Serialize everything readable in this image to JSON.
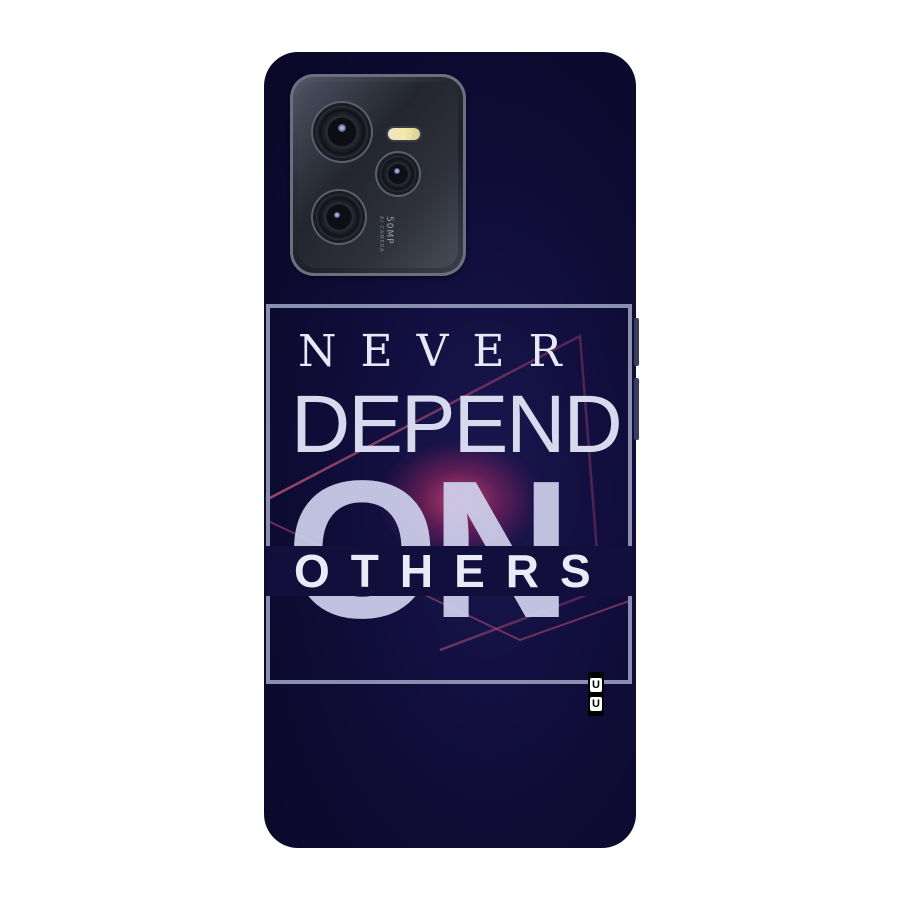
{
  "artwork": {
    "line1": "NEVER",
    "line2": "DEPEND",
    "line3": "ON",
    "line4": "OTHERS"
  },
  "camera": {
    "spec_label": "50MP",
    "sub_label": "AI CAMERA"
  },
  "brand": {
    "top_letter": "U",
    "bottom_letter": "U"
  },
  "colors": {
    "background": "#ffffff",
    "case": "#100d3a",
    "text": "#d7d9ee",
    "accent_glow": "#d2466e"
  }
}
